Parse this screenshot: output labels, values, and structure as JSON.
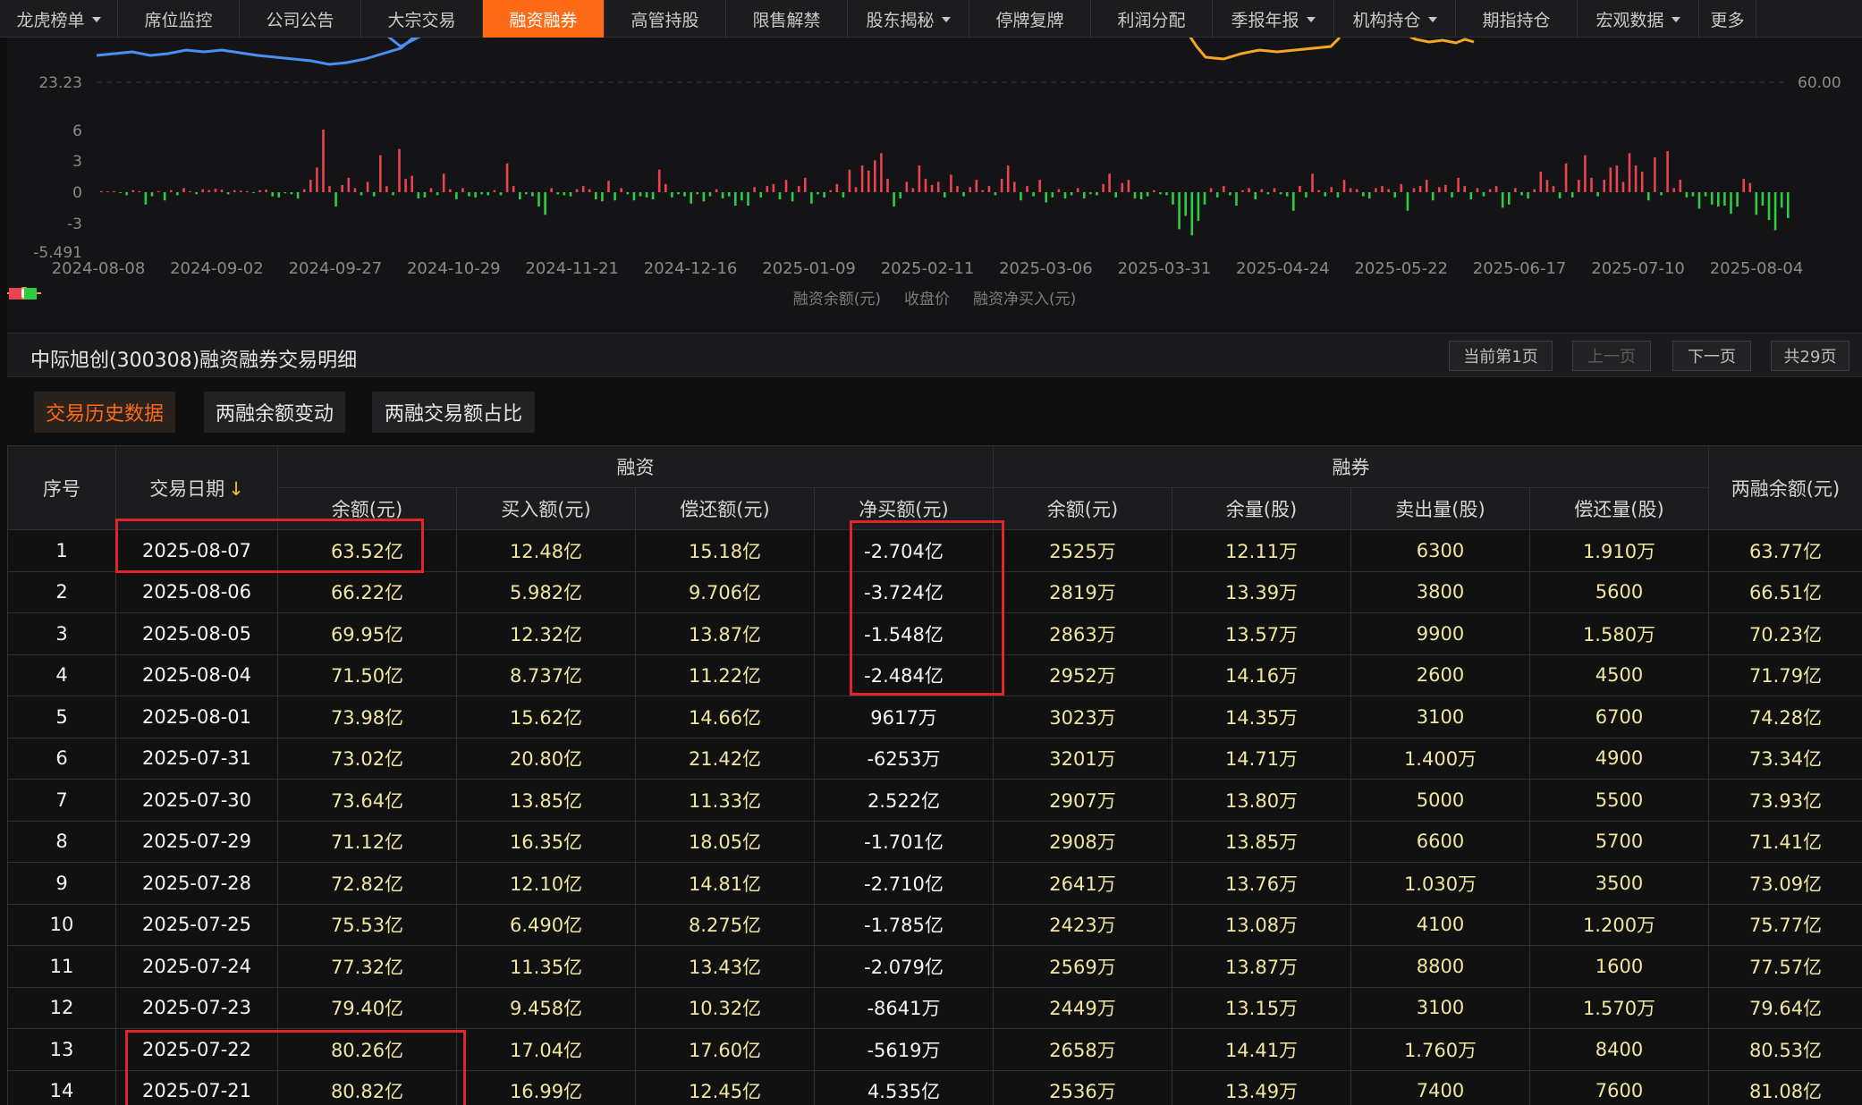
{
  "nav": {
    "items": [
      {
        "label": "龙虎榜单",
        "dropdown": true,
        "width": 132
      },
      {
        "label": "席位监控",
        "dropdown": false,
        "width": 136
      },
      {
        "label": "公司公告",
        "dropdown": false,
        "width": 136
      },
      {
        "label": "大宗交易",
        "dropdown": false,
        "width": 136
      },
      {
        "label": "融资融券",
        "dropdown": false,
        "width": 136,
        "active": true
      },
      {
        "label": "高管持股",
        "dropdown": false,
        "width": 136
      },
      {
        "label": "限售解禁",
        "dropdown": false,
        "width": 136
      },
      {
        "label": "股东揭秘",
        "dropdown": true,
        "width": 136
      },
      {
        "label": "停牌复牌",
        "dropdown": false,
        "width": 136
      },
      {
        "label": "利润分配",
        "dropdown": false,
        "width": 136
      },
      {
        "label": "季报年报",
        "dropdown": true,
        "width": 136
      },
      {
        "label": "机构持仓",
        "dropdown": true,
        "width": 136
      },
      {
        "label": "期指持仓",
        "dropdown": false,
        "width": 136
      },
      {
        "label": "宏观数据",
        "dropdown": true,
        "width": 136
      },
      {
        "label": "更多",
        "dropdown": false,
        "width": 64
      }
    ]
  },
  "chart_data": {
    "type": "bar",
    "left_axis_ticks": [
      "23.23",
      "6",
      "3",
      "0",
      "-3",
      "-5.491"
    ],
    "right_axis_ticks": [
      "60.00"
    ],
    "x_tick_labels": [
      "2024-08-08",
      "2024-09-02",
      "2024-09-27",
      "2024-10-29",
      "2024-11-21",
      "2024-12-16",
      "2025-01-09",
      "2025-02-11",
      "2025-03-06",
      "2025-03-31",
      "2025-04-24",
      "2025-05-22",
      "2025-06-17",
      "2025-07-10",
      "2025-08-04"
    ],
    "net_buy_ylim": [
      -5.491,
      7.5
    ],
    "legend": [
      "融资余额(元)",
      "收盘价",
      "融资净买入(元)"
    ],
    "colors": {
      "balance_line": "#4a90f0",
      "close_line": "#f5a623",
      "positive": "#e8434f",
      "negative": "#2ecc40"
    },
    "net_buy_values": [
      0.1,
      0.05,
      0.1,
      -0.05,
      -0.3,
      0.2,
      0.1,
      -1.2,
      -0.4,
      0.1,
      -0.8,
      0.2,
      -0.3,
      0.4,
      0.1,
      -0.2,
      0.3,
      0.2,
      0.35,
      0.25,
      -0.2,
      0.2,
      0.15,
      0.1,
      -0.05,
      0.2,
      0.25,
      -0.4,
      -0.5,
      -0.1,
      -0.2,
      -0.6,
      0.3,
      1.2,
      2.4,
      6.1,
      0.6,
      -1.4,
      0.7,
      1.4,
      0.4,
      -0.3,
      1.0,
      -0.4,
      3.6,
      0.6,
      -0.3,
      4.2,
      1.3,
      1.6,
      -0.6,
      -0.5,
      0.4,
      -0.3,
      1.8,
      0.3,
      -0.7,
      0.4,
      -0.4,
      -0.5,
      -0.2,
      -0.3,
      0.2,
      -0.3,
      2.8,
      0.6,
      -0.7,
      -0.2,
      -0.4,
      -1.4,
      -2.2,
      0.4,
      -0.2,
      -0.3,
      -0.4,
      0.3,
      0.6,
      0.3,
      -0.7,
      -0.9,
      1.1,
      -0.8,
      0.4,
      -0.2,
      -0.8,
      -0.4,
      -0.5,
      -0.7,
      2.2,
      0.8,
      -0.5,
      -0.2,
      -0.4,
      -1.1,
      -0.2,
      -0.9,
      -0.4,
      0.3,
      -0.6,
      -0.4,
      -1.3,
      -0.8,
      -1.3,
      0.5,
      -0.5,
      0.6,
      0.8,
      -0.7,
      1.2,
      -0.9,
      0.6,
      1.4,
      -1.1,
      -0.2,
      -0.5,
      0.2,
      0.8,
      -0.5,
      2.2,
      0.5,
      2.6,
      2.1,
      3.1,
      3.8,
      1.3,
      -1.4,
      -0.6,
      1.0,
      0.4,
      2.6,
      1.3,
      0.7,
      1.0,
      -0.5,
      1.7,
      0.6,
      -0.4,
      0.5,
      1.2,
      0.2,
      0.6,
      -0.3,
      1.3,
      2.6,
      1.0,
      -0.8,
      0.6,
      -0.4,
      1.2,
      -1.0,
      -0.5,
      0.3,
      -0.6,
      -0.3,
      0.4,
      -0.6,
      -0.2,
      -0.3,
      0.8,
      1.8,
      -0.5,
      0.9,
      1.2,
      -0.6,
      -0.7,
      -0.4,
      0.2,
      -0.2,
      -0.3,
      -1.2,
      -3.6,
      -2.3,
      -4.2,
      -2.8,
      -1.2,
      0.4,
      -0.5,
      0.6,
      -0.3,
      -1.3,
      0.2,
      0.4,
      -0.7,
      0.3,
      -0.2,
      0.4,
      -0.2,
      -0.4,
      -1.8,
      0.6,
      -0.5,
      1.8,
      0.2,
      -0.4,
      0.5,
      -0.5,
      1.2,
      0.4,
      0.3,
      -0.4,
      -0.6,
      0.4,
      0.6,
      0.3,
      -0.5,
      0.8,
      -1.8,
      0.4,
      0.6,
      1.2,
      -0.8,
      0.5,
      0.7,
      -0.5,
      1.4,
      0.6,
      -0.7,
      0.4,
      -0.4,
      0.3,
      0.6,
      -1.5,
      -1.2,
      0.4,
      -0.3,
      -0.6,
      0.3,
      2.0,
      1.2,
      0.6,
      -0.6,
      2.8,
      -0.5,
      1.2,
      3.6,
      1.4,
      -0.4,
      1.2,
      2.4,
      2.6,
      1.0,
      3.8,
      2.6,
      2.0,
      -0.8,
      3.4,
      -0.3,
      4.0,
      0.4,
      1.2,
      -0.5,
      -0.4,
      -1.6,
      -0.4,
      -1.2,
      -1.4,
      -1.3,
      -2.1,
      -1.4,
      1.3,
      0.9,
      -2.2,
      -1.3,
      -2.7,
      -3.7,
      -1.5,
      -2.5
    ]
  },
  "detail": {
    "title": "中际旭创(300308)融资融券交易明细",
    "pager": {
      "current": "当前第1页",
      "prev": "上一页",
      "next": "下一页",
      "total": "共29页"
    }
  },
  "tabs": [
    {
      "label": "交易历史数据",
      "active": true
    },
    {
      "label": "两融余额变动",
      "active": false
    },
    {
      "label": "两融交易额占比",
      "active": false
    }
  ],
  "table": {
    "group_headers": {
      "seq": "序号",
      "date": "交易日期",
      "date_sort": "↓",
      "financing": "融资",
      "lending": "融券",
      "total": "两融余额(元)"
    },
    "sub_headers": [
      "余额(元)",
      "买入额(元)",
      "偿还额(元)",
      "净买额(元)",
      "余额(元)",
      "余量(股)",
      "卖出量(股)",
      "偿还量(股)"
    ],
    "rows": [
      [
        "1",
        "2025-08-07",
        "63.52亿",
        "12.48亿",
        "15.18亿",
        "-2.704亿",
        "2525万",
        "12.11万",
        "6300",
        "1.910万",
        "63.77亿"
      ],
      [
        "2",
        "2025-08-06",
        "66.22亿",
        "5.982亿",
        "9.706亿",
        "-3.724亿",
        "2819万",
        "13.39万",
        "3800",
        "5600",
        "66.51亿"
      ],
      [
        "3",
        "2025-08-05",
        "69.95亿",
        "12.32亿",
        "13.87亿",
        "-1.548亿",
        "2863万",
        "13.57万",
        "9900",
        "1.580万",
        "70.23亿"
      ],
      [
        "4",
        "2025-08-04",
        "71.50亿",
        "8.737亿",
        "11.22亿",
        "-2.484亿",
        "2952万",
        "14.16万",
        "2600",
        "4500",
        "71.79亿"
      ],
      [
        "5",
        "2025-08-01",
        "73.98亿",
        "15.62亿",
        "14.66亿",
        "9617万",
        "3023万",
        "14.35万",
        "3100",
        "6700",
        "74.28亿"
      ],
      [
        "6",
        "2025-07-31",
        "73.02亿",
        "20.80亿",
        "21.42亿",
        "-6253万",
        "3201万",
        "14.71万",
        "1.400万",
        "4900",
        "73.34亿"
      ],
      [
        "7",
        "2025-07-30",
        "73.64亿",
        "13.85亿",
        "11.33亿",
        "2.522亿",
        "2907万",
        "13.80万",
        "5000",
        "5500",
        "73.93亿"
      ],
      [
        "8",
        "2025-07-29",
        "71.12亿",
        "16.35亿",
        "18.05亿",
        "-1.701亿",
        "2908万",
        "13.85万",
        "6600",
        "5700",
        "71.41亿"
      ],
      [
        "9",
        "2025-07-28",
        "72.82亿",
        "12.10亿",
        "14.81亿",
        "-2.710亿",
        "2641万",
        "13.76万",
        "1.030万",
        "3500",
        "73.09亿"
      ],
      [
        "10",
        "2025-07-25",
        "75.53亿",
        "6.490亿",
        "8.275亿",
        "-1.785亿",
        "2423万",
        "13.08万",
        "4100",
        "1.200万",
        "75.77亿"
      ],
      [
        "11",
        "2025-07-24",
        "77.32亿",
        "11.35亿",
        "13.43亿",
        "-2.079亿",
        "2569万",
        "13.87万",
        "8800",
        "1600",
        "77.57亿"
      ],
      [
        "12",
        "2025-07-23",
        "79.40亿",
        "9.458亿",
        "10.32亿",
        "-8641万",
        "2449万",
        "13.15万",
        "3100",
        "1.570万",
        "79.64亿"
      ],
      [
        "13",
        "2025-07-22",
        "80.26亿",
        "17.04亿",
        "17.60亿",
        "-5619万",
        "2658万",
        "14.41万",
        "1.760万",
        "8400",
        "80.53亿"
      ],
      [
        "14",
        "2025-07-21",
        "80.82亿",
        "16.99亿",
        "12.45亿",
        "4.535亿",
        "2536万",
        "13.49万",
        "7400",
        "7600",
        "81.08亿"
      ]
    ]
  }
}
